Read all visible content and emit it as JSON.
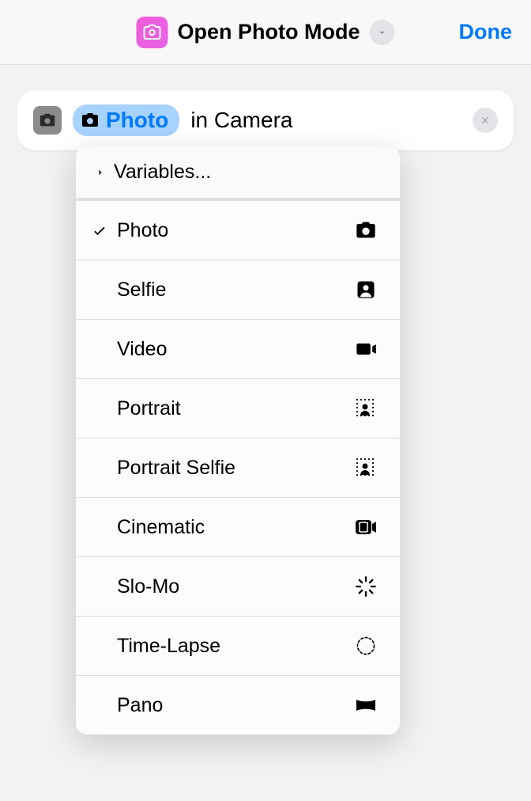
{
  "header": {
    "title": "Open Photo Mode",
    "done_label": "Done"
  },
  "action": {
    "token_label": "Photo",
    "suffix": "in Camera"
  },
  "dropdown": {
    "variables_label": "Variables...",
    "options": [
      {
        "label": "Photo",
        "icon": "camera",
        "selected": true
      },
      {
        "label": "Selfie",
        "icon": "person-square",
        "selected": false
      },
      {
        "label": "Video",
        "icon": "video",
        "selected": false
      },
      {
        "label": "Portrait",
        "icon": "portrait",
        "selected": false
      },
      {
        "label": "Portrait Selfie",
        "icon": "portrait",
        "selected": false
      },
      {
        "label": "Cinematic",
        "icon": "cinematic",
        "selected": false
      },
      {
        "label": "Slo-Mo",
        "icon": "slomo",
        "selected": false
      },
      {
        "label": "Time-Lapse",
        "icon": "timelapse",
        "selected": false
      },
      {
        "label": "Pano",
        "icon": "pano",
        "selected": false
      }
    ]
  }
}
